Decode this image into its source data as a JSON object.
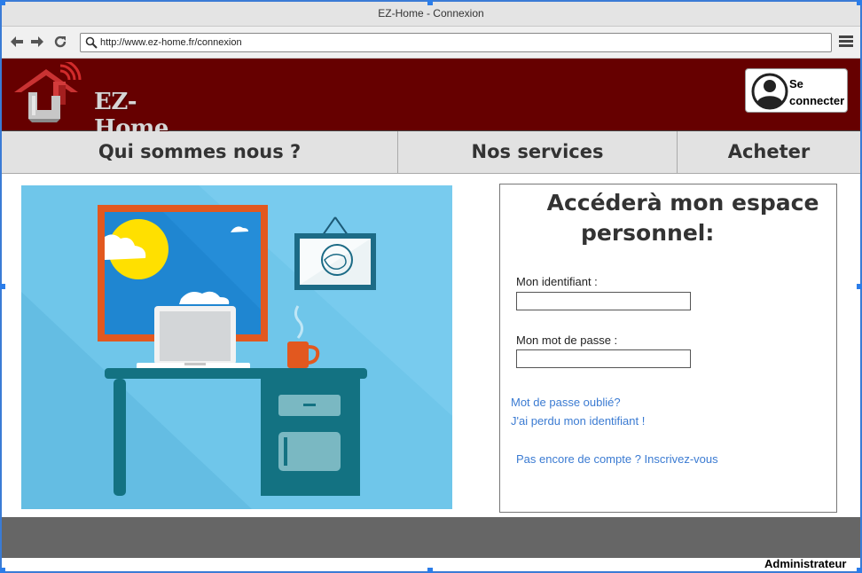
{
  "window": {
    "title": "EZ-Home - Connexion"
  },
  "browser": {
    "url": "http://www.ez-home.fr/connexion",
    "back_icon": "arrow-left-icon",
    "forward_icon": "arrow-right-icon",
    "reload_icon": "reload-icon",
    "menu_icon": "hamburger-icon"
  },
  "header": {
    "logo_text": "EZ-Home",
    "login_label": "Se connecter",
    "colors": {
      "header_bg": "#660000",
      "logo_red": "#c0282a"
    }
  },
  "nav": {
    "items": [
      {
        "label": "Qui sommes nous ?"
      },
      {
        "label": "Nos services"
      },
      {
        "label": "Acheter"
      }
    ]
  },
  "login_panel": {
    "title_line1": "Accéderà mon espace",
    "title_line2": "personnel:",
    "username_label": "Mon identifiant :",
    "username_value": "",
    "password_label": "Mon mot de passe :",
    "password_value": "",
    "forgot_password": "Mot de passe oublié?",
    "forgot_id": "J'ai perdu mon identifiant !",
    "signup": "Pas encore de compte ? Inscrivez-vous",
    "link_color": "#3b7bd2"
  },
  "footer": {
    "admin_label": "Administrateur",
    "bg_color": "#666666"
  }
}
